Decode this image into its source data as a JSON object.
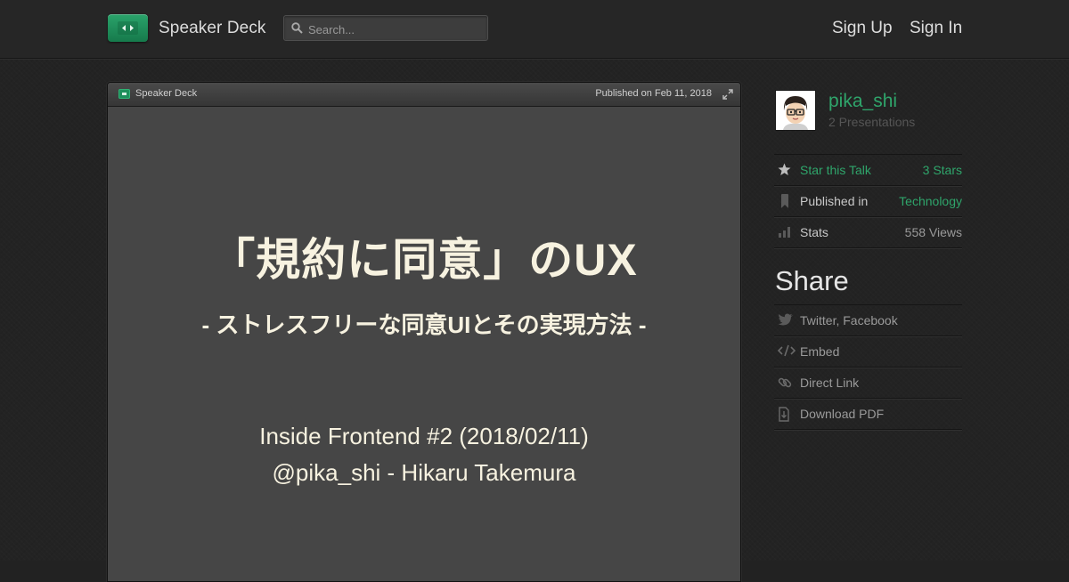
{
  "header": {
    "brand": "Speaker Deck",
    "search_placeholder": "Search...",
    "sign_up": "Sign Up",
    "sign_in": "Sign In"
  },
  "player": {
    "brand": "Speaker Deck",
    "published": "Published on Feb 11, 2018"
  },
  "slide": {
    "title": "「規約に同意」のUX",
    "subtitle": "- ストレスフリーな同意UIとその実現方法 -",
    "event": "Inside Frontend #2 (2018/02/11)",
    "author_line": "@pika_shi  -  Hikaru Takemura"
  },
  "sidebar": {
    "author": {
      "name": "pika_shi",
      "presentations": "2 Presentations"
    },
    "meta": [
      {
        "icon": "star-icon",
        "label": "Star this Talk",
        "value": "3 Stars"
      },
      {
        "icon": "bookmark-icon",
        "label": "Published in",
        "value": "Technology"
      },
      {
        "icon": "bar-chart-icon",
        "label": "Stats",
        "value": "558 Views"
      }
    ],
    "share_title": "Share",
    "share": [
      {
        "icon": "twitter-bird-icon",
        "label": "Twitter, Facebook"
      },
      {
        "icon": "code-icon",
        "label": "Embed"
      },
      {
        "icon": "link-icon",
        "label": "Direct Link"
      },
      {
        "icon": "download-pdf-icon",
        "label": "Download PDF"
      }
    ]
  },
  "colors": {
    "accent_green": "#2fa56b",
    "background": "#232323",
    "slide_background": "#464646",
    "slide_text": "#f7f2e0"
  }
}
